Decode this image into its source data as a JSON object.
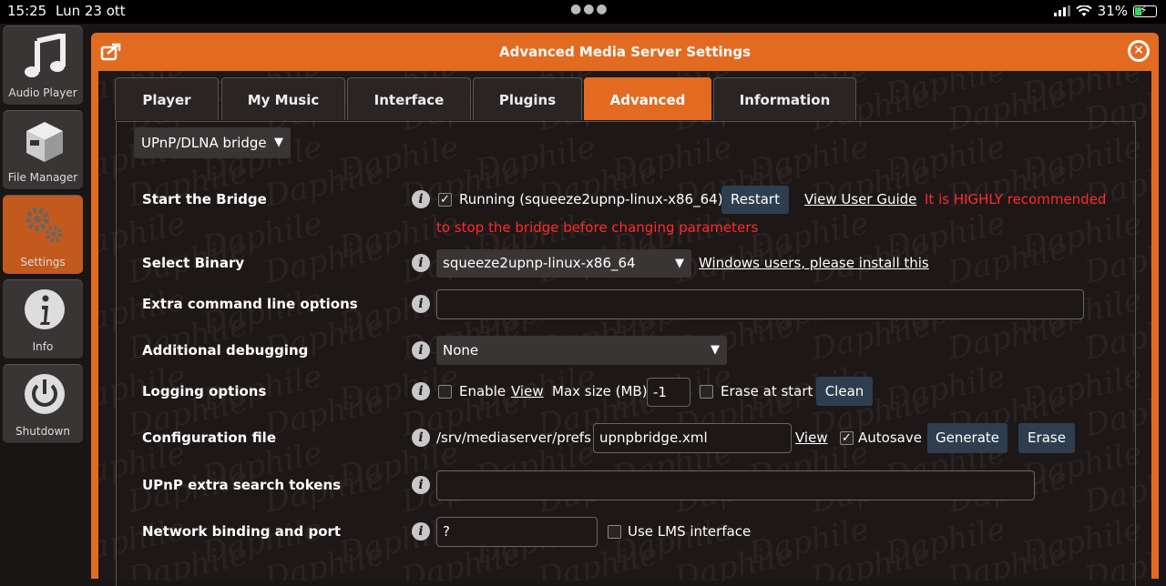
{
  "status_bar": {
    "time": "15:25",
    "date": "Lun 23 ott",
    "battery": "31%"
  },
  "sidebar": {
    "items": [
      {
        "label": "Audio Player",
        "icon": "music-note-icon"
      },
      {
        "label": "File Manager",
        "icon": "box-icon"
      },
      {
        "label": "Settings",
        "icon": "gears-icon"
      },
      {
        "label": "Info",
        "icon": "info-icon"
      },
      {
        "label": "Shutdown",
        "icon": "power-icon"
      }
    ]
  },
  "dialog": {
    "title": "Advanced Media Server Settings",
    "tabs": [
      "Player",
      "My Music",
      "Interface",
      "Plugins",
      "Advanced",
      "Information"
    ],
    "active_tab": "Advanced",
    "section_select": "UPnP/DLNA bridge",
    "watermark": "Daphile"
  },
  "form": {
    "start_bridge": {
      "label": "Start the Bridge",
      "running_text": "Running (squeeze2upnp-linux-x86_64)",
      "running_checked": true,
      "restart": "Restart",
      "guide": "View User Guide",
      "warning_1": "It is HIGHLY recommended",
      "warning_2": "to stop the bridge before changing parameters"
    },
    "select_binary": {
      "label": "Select Binary",
      "value": "squeeze2upnp-linux-x86_64",
      "link": "Windows users, please install this"
    },
    "extra_options": {
      "label": "Extra command line options",
      "value": ""
    },
    "debugging": {
      "label": "Additional debugging",
      "value": "None"
    },
    "logging": {
      "label": "Logging options",
      "enable": "Enable",
      "view": "View",
      "max_size_label": "Max size (MB)",
      "max_size": "-1",
      "erase": "Erase at start",
      "clean": "Clean"
    },
    "config": {
      "label": "Configuration file",
      "path": "/srv/mediaserver/prefs",
      "file": "upnpbridge.xml",
      "view": "View",
      "autosave": "Autosave",
      "generate": "Generate",
      "erase": "Erase"
    },
    "search_tokens": {
      "label": "UPnP extra search tokens",
      "value": ""
    },
    "network": {
      "label": "Network binding and port",
      "value": "?",
      "use_lms": "Use LMS interface"
    }
  },
  "colors": {
    "accent": "#e26b21",
    "warning": "#ff2a2a",
    "button": "#2e3e4f"
  }
}
